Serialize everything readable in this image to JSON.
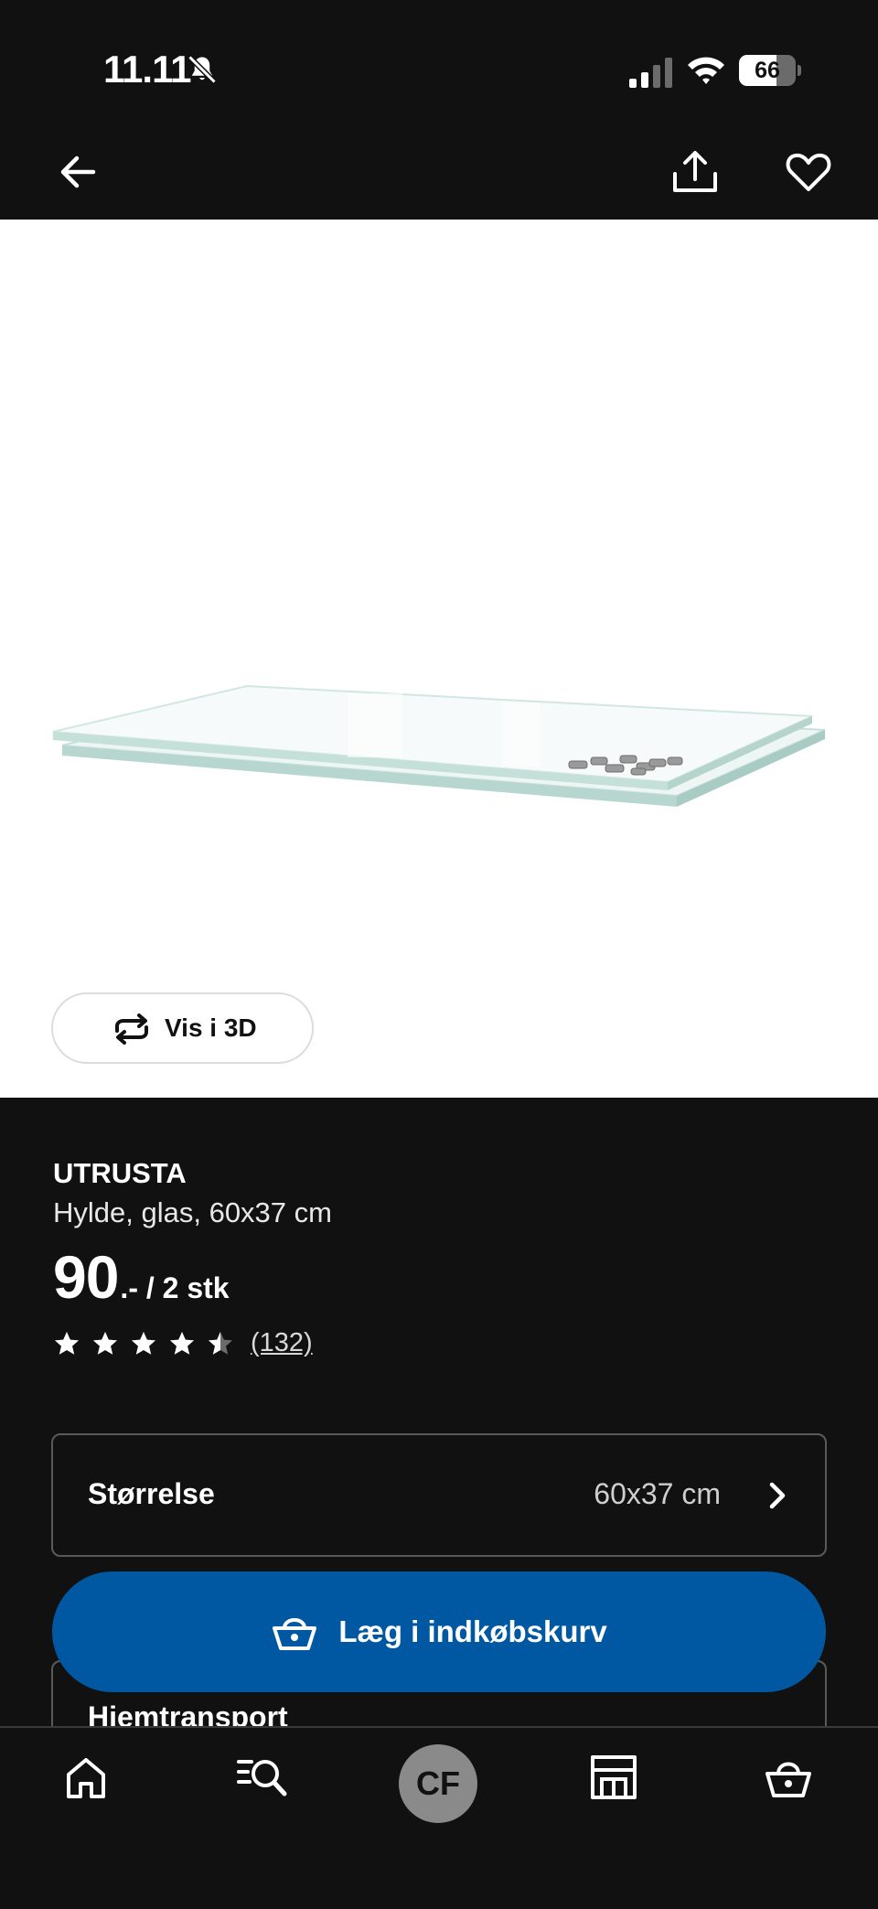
{
  "status_bar": {
    "time": "11.11",
    "battery_level": "66",
    "battery_fraction": 0.66,
    "icons": [
      "bell-slash-icon",
      "signal-icon",
      "wifi-icon",
      "battery-icon"
    ]
  },
  "top_nav": {
    "icons": [
      "arrow-left-icon",
      "share-icon",
      "heart-icon"
    ]
  },
  "product": {
    "image": "glass-shelf-image",
    "view_3d_label": "Vis i 3D",
    "name": "UTRUSTA",
    "description": "Hylde, glas, 60x37 cm",
    "price_main": "90",
    "price_suffix": ".- / 2 stk",
    "rating": 4.5,
    "rating_max": 5,
    "review_count": "(132)"
  },
  "size_selector": {
    "label": "Størrelse",
    "value": "60x37 cm"
  },
  "add_to_cart": {
    "label": "Læg i indkøbskurv"
  },
  "delivery": {
    "label": "Hjemtransport"
  },
  "tab_bar": {
    "profile_initials": "CF",
    "items": [
      "home-icon",
      "search-icon",
      "profile-avatar",
      "store-icon",
      "cart-icon"
    ]
  },
  "colors": {
    "background": "#111111",
    "accent_blue": "#0058a3",
    "text": "#ffffff"
  }
}
